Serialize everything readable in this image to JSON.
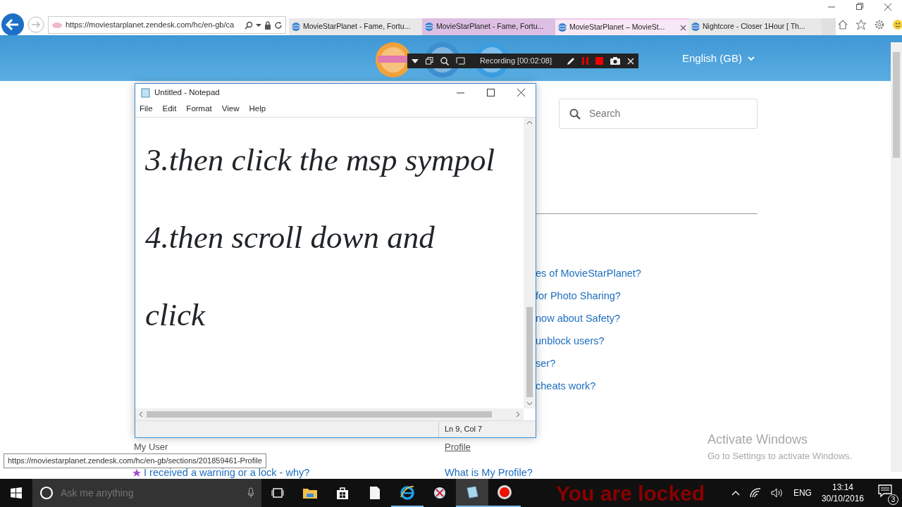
{
  "browser": {
    "address": "https://moviestarplanet.zendesk.com/hc/en-gb/ca",
    "tabs": [
      {
        "title": "MovieStarPlanet - Fame, Fortu...",
        "selected": false,
        "color": "#e8e8e8",
        "closable": false
      },
      {
        "title": "MovieStarPlanet - Fame, Fortu...",
        "selected": false,
        "color": "#dcbfe3",
        "closable": false
      },
      {
        "title": "MovieStarPlanet – MovieSt...",
        "selected": true,
        "color": "#f8e8f6",
        "closable": true
      },
      {
        "title": "Nightcore - Closer 1Hour [ Th...",
        "selected": false,
        "color": "#e8e8e8",
        "closable": false
      }
    ],
    "status_url": "https://moviestarplanet.zendesk.com/hc/en-gb/sections/201859461-Profile"
  },
  "page": {
    "language": "English (GB)",
    "search": {
      "placeholder": "Search"
    },
    "links": [
      "es of MovieStarPlanet?",
      "for Photo Sharing?",
      "now about Safety?",
      "unblock users?",
      "ser?",
      "cheats work?"
    ],
    "sections": [
      {
        "title": "My User",
        "underlined": false,
        "question": "I received a warning or a lock - why?",
        "starred": true
      },
      {
        "title": "Profile",
        "underlined": true,
        "question": "What is My Profile?",
        "starred": false
      }
    ]
  },
  "recorder": {
    "status": "Recording [00:02:08]"
  },
  "notepad": {
    "title": "Untitled - Notepad",
    "menu": [
      "File",
      "Edit",
      "Format",
      "View",
      "Help"
    ],
    "lines": [
      "3.then click the msp sympol",
      "4.then scroll down and",
      "click"
    ],
    "status": "Ln 9, Col 7"
  },
  "activation": {
    "title": "Activate Windows",
    "hint": "Go to Settings to activate Windows."
  },
  "overlay_text": "You are locked",
  "taskbar": {
    "search": {
      "placeholder": "Ask me anything"
    },
    "apps": [
      {
        "kind": "taskview",
        "running": false,
        "selected": false
      },
      {
        "kind": "explorer",
        "running": false,
        "selected": false
      },
      {
        "kind": "store",
        "running": false,
        "selected": false
      },
      {
        "kind": "file",
        "running": false,
        "selected": false
      },
      {
        "kind": "ie",
        "running": true,
        "selected": false
      },
      {
        "kind": "paint",
        "running": false,
        "selected": false
      },
      {
        "kind": "notepad",
        "running": true,
        "selected": true
      },
      {
        "kind": "record",
        "running": true,
        "selected": false
      }
    ],
    "language": "ENG",
    "time": "13:14",
    "date": "30/10/2016",
    "notifications": "3"
  }
}
